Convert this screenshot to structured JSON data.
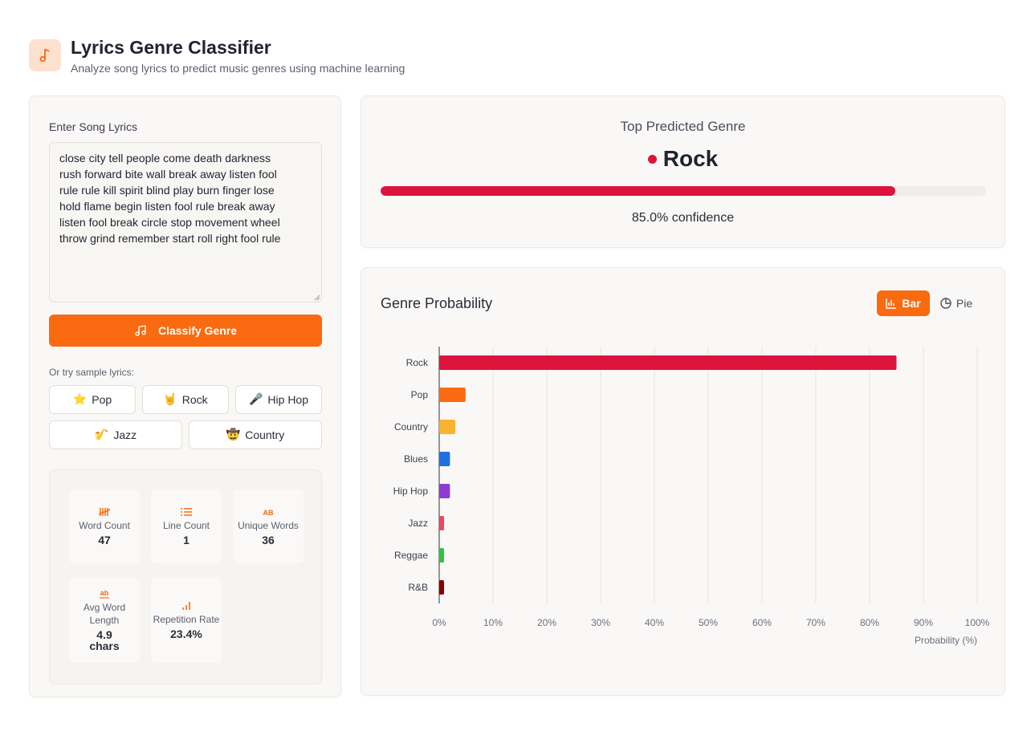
{
  "header": {
    "title": "Lyrics Genre Classifier",
    "subtitle": "Analyze song lyrics to predict music genres using machine learning",
    "logo_icon": "music-note-icon"
  },
  "input": {
    "label": "Enter Song Lyrics",
    "lyrics": "close city tell people come death darkness\nrush forward bite wall break away listen fool\nrule rule kill spirit blind play burn finger lose\nhold flame begin listen fool rule break away\nlisten fool break circle stop movement wheel\nthrow grind remember start roll right fool rule",
    "classify_label": "Classify Genre",
    "classify_icon": "music-notes-icon"
  },
  "samples": {
    "label": "Or try sample lyrics:",
    "items": [
      {
        "emoji": "⭐",
        "label": "Pop"
      },
      {
        "emoji": "🤘",
        "label": "Rock"
      },
      {
        "emoji": "🎤",
        "label": "Hip Hop"
      },
      {
        "emoji": "🎷",
        "label": "Jazz"
      },
      {
        "emoji": "🤠",
        "label": "Country"
      }
    ]
  },
  "stats": {
    "word_count": {
      "label": "Word Count",
      "value": "47",
      "icon": "tally-icon"
    },
    "line_count": {
      "label": "Line Count",
      "value": "1",
      "icon": "list-icon"
    },
    "unique_words": {
      "label": "Unique Words",
      "value": "36",
      "icon": "letters-ab-icon"
    },
    "avg_word_length": {
      "label": "Avg Word Length",
      "value": "4.9 chars",
      "icon": "text-ab-icon"
    },
    "repetition_rate": {
      "label": "Repetition Rate",
      "value": "23.4%",
      "icon": "bar-chart-icon"
    }
  },
  "top_prediction": {
    "title": "Top Predicted Genre",
    "genre": "Rock",
    "confidence": 85.0,
    "confidence_text": "85.0% confidence",
    "color": "#dc143c"
  },
  "chart_panel": {
    "title": "Genre Probability",
    "bar_label": "Bar",
    "pie_label": "Pie",
    "active_view": "Bar"
  },
  "colors": {
    "accent": "#fa6a10"
  },
  "chart_data": {
    "type": "bar",
    "orientation": "horizontal",
    "categories": [
      "Rock",
      "Pop",
      "Country",
      "Blues",
      "Hip Hop",
      "Jazz",
      "Reggae",
      "R&B"
    ],
    "values": [
      85.0,
      4.9,
      3.0,
      2.0,
      2.0,
      0.9,
      0.9,
      0.9
    ],
    "colors": [
      "#dc143c",
      "#fa6a10",
      "#f8b431",
      "#1e6fe0",
      "#8e3bd1",
      "#f0465f",
      "#33c03f",
      "#8b0000"
    ],
    "xlabel": "Probability (%)",
    "xlim": [
      0,
      100
    ],
    "xticks": [
      "0%",
      "10%",
      "20%",
      "30%",
      "40%",
      "50%",
      "60%",
      "70%",
      "80%",
      "90%",
      "100%"
    ],
    "grid": true
  }
}
